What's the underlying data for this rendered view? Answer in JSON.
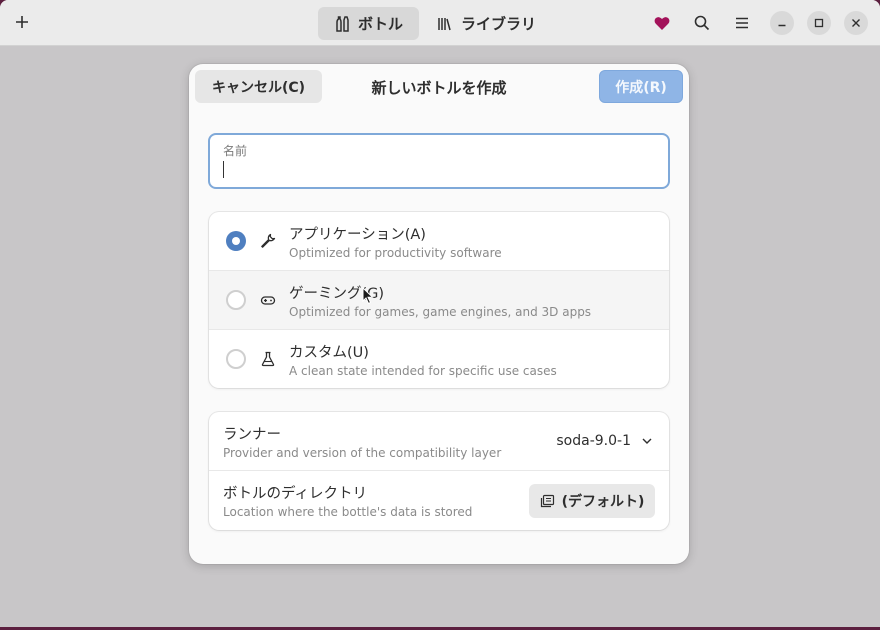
{
  "header": {
    "tabs": [
      {
        "label": "ボトル",
        "icon": "bottles-icon",
        "active": true
      },
      {
        "label": "ライブラリ",
        "icon": "library-icon",
        "active": false
      }
    ],
    "heart_color": "#a3125a"
  },
  "dialog": {
    "cancel_label": "キャンセル(C)",
    "title": "新しいボトルを作成",
    "create_label": "作成(R)",
    "name_label": "名前",
    "name_value": "",
    "environments": [
      {
        "title": "アプリケーション(A)",
        "subtitle": "Optimized for productivity software",
        "icon": "wrench-icon",
        "selected": true
      },
      {
        "title": "ゲーミング(G)",
        "subtitle": "Optimized for games, game engines, and 3D apps",
        "icon": "gamepad-icon",
        "selected": false
      },
      {
        "title": "カスタム(U)",
        "subtitle": "A clean state intended for specific use cases",
        "icon": "flask-icon",
        "selected": false
      }
    ],
    "runner": {
      "title": "ランナー",
      "subtitle": "Provider and version of the compatibility layer",
      "value": "soda-9.0-1"
    },
    "directory": {
      "title": "ボトルのディレクトリ",
      "subtitle": "Location where the bottle's data is stored",
      "button_label": "(デフォルト)"
    }
  },
  "colors": {
    "accent": "#4f7fc0",
    "suggested_button": "#8fb5e6",
    "desktop": "#5c1f3f"
  }
}
